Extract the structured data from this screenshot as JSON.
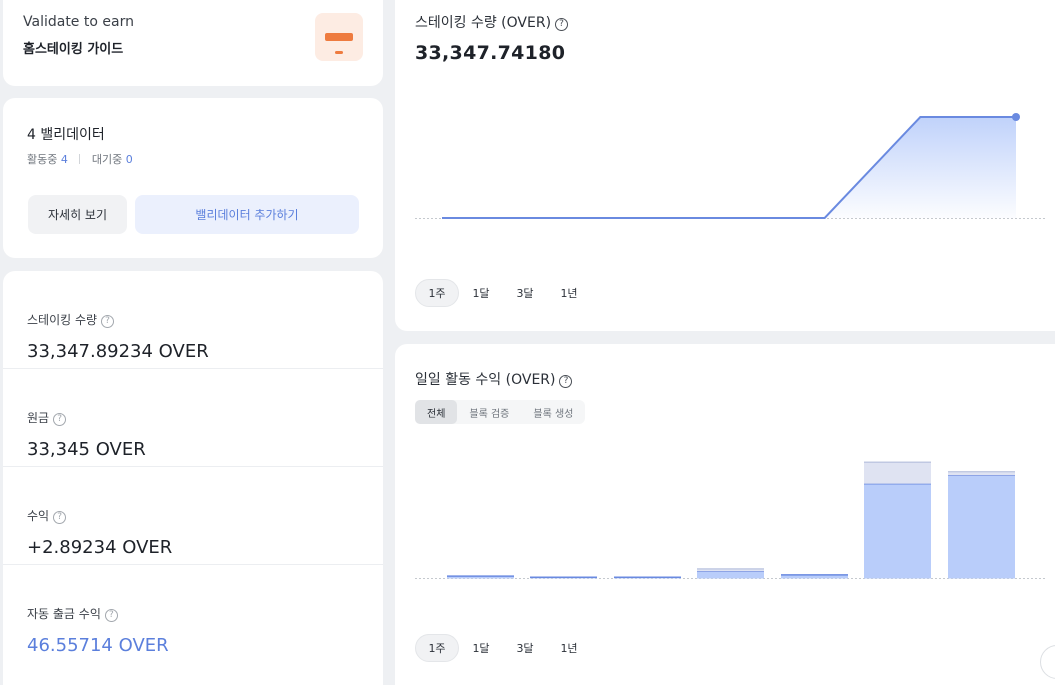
{
  "guide": {
    "subtitle": "Validate to earn",
    "title": "홈스테이킹 가이드",
    "icon": "card-icon",
    "accent": "#ee7b3f"
  },
  "validators": {
    "title": "4 밸리데이터",
    "active_label": "활동중",
    "active_count": "4",
    "waiting_label": "대기중",
    "waiting_count": "0",
    "detail_button": "자세히 보기",
    "add_button": "밸리데이터 추가하기"
  },
  "stats": [
    {
      "label": "스테이킹 수량",
      "value": "33,347.89234 OVER"
    },
    {
      "label": "원금",
      "value": "33,345 OVER"
    },
    {
      "label": "수익",
      "value": "+2.89234 OVER"
    },
    {
      "label": "자동 출금 수익",
      "value": "46.55714 OVER"
    }
  ],
  "staking_chart": {
    "title": "스테이킹 수량 (OVER)",
    "value": "33,347.74180",
    "periods": [
      "1주",
      "1달",
      "3달",
      "1년"
    ],
    "active_period": "1주"
  },
  "daily_chart": {
    "title": "일일 활동 수익 (OVER)",
    "tabs": [
      "전체",
      "블록 검증",
      "블록 생성"
    ],
    "active_tab": "전체",
    "periods": [
      "1주",
      "1달",
      "3달",
      "1년"
    ],
    "active_period": "1주"
  },
  "colors": {
    "accent": "#5b7fdc",
    "line": "#6a8ae0",
    "bar_fill": "#b9cdfa",
    "bar_top": "#dfe3f2"
  },
  "chart_data": [
    {
      "type": "area",
      "title": "스테이킹 수량 (OVER)",
      "xlabel": "",
      "ylabel": "",
      "x": [
        1,
        2,
        3,
        4,
        5,
        6,
        7
      ],
      "series": [
        {
          "values": [
            33345.0,
            33345.0,
            33345.0,
            33345.0,
            33345.0,
            33347.74,
            33347.74
          ]
        }
      ],
      "ylim": [
        33344.5,
        33348.0
      ],
      "grid": false
    },
    {
      "type": "bar",
      "title": "일일 활동 수익 (OVER)",
      "xlabel": "",
      "ylabel": "",
      "categories": [
        "1",
        "2",
        "3",
        "4",
        "5",
        "6",
        "7"
      ],
      "series": [
        {
          "values": [
            0.02,
            0.01,
            0.01,
            0.06,
            0.03,
            0.79,
            0.86
          ]
        },
        {
          "values": [
            0.0,
            0.0,
            0.0,
            0.02,
            0.0,
            0.18,
            0.03
          ]
        }
      ],
      "ylim": [
        0,
        1.0
      ],
      "grid": false
    }
  ]
}
